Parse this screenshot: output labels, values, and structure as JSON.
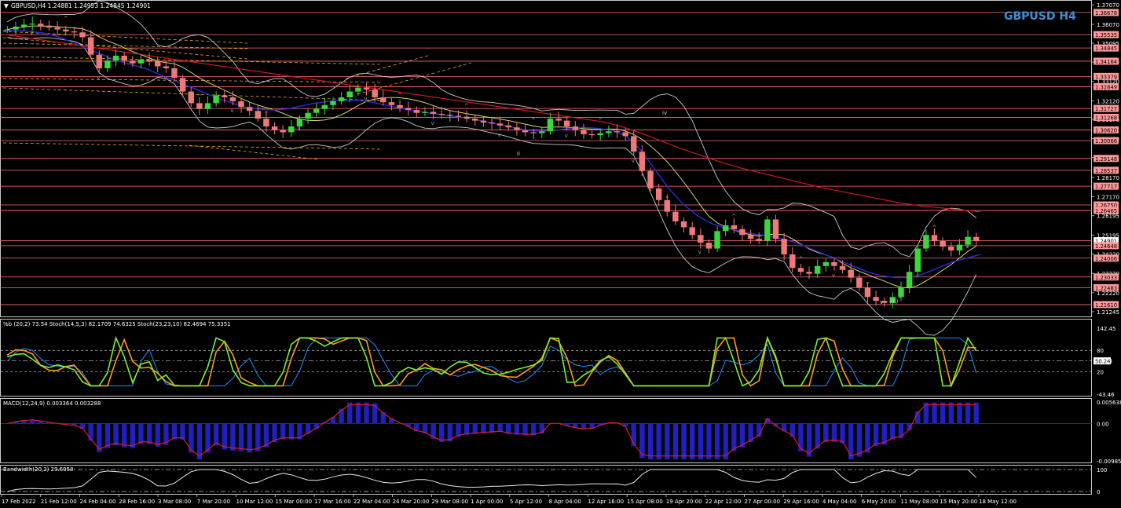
{
  "header": {
    "main": "GBPUSD,H4  1.24881 1.24953 1.24845 1.24901",
    "symbol_title": "GBPUSD H4"
  },
  "colors": {
    "bg": "#000000",
    "grid_frame": "#c8c8c8",
    "level_line": "#ff6e6e",
    "badge": "#ff9898",
    "bull": "#3ad83a",
    "bear": "#f07878",
    "ma_blue": "#2b2bd8",
    "ma_red": "#d01818",
    "ma_yellow": "#e8e86a",
    "bands": "#c8c8c8",
    "fib": "#e8a620",
    "title": "#3e8fd6",
    "stoch_green": "#7cf02c",
    "stoch_orange": "#ff9a1c",
    "pctb_blue": "#1e90ff",
    "macd_hist": "#2020c0",
    "macd_signal": "#e01c1c",
    "bw_line": "#e8e8e8"
  },
  "price_axis": {
    "labels": [
      "1.37070",
      "1.36070",
      "1.35095",
      "1.34120",
      "1.33120",
      "1.32120",
      "1.31170",
      "1.30170",
      "1.29195",
      "1.28170",
      "1.27170",
      "1.26195",
      "1.25195",
      "1.24220",
      "1.23220",
      "1.22220",
      "1.21245"
    ]
  },
  "levels": [
    "1.36678",
    "1.35535",
    "1.34845",
    "1.34164",
    "1.33379",
    "1.32849",
    "1.31727",
    "1.31268",
    "1.30620",
    "1.30066",
    "1.29148",
    "1.28537",
    "1.27717",
    "1.26750",
    "1.26465",
    "1.24901",
    "1.24648",
    "1.24006",
    "1.23033",
    "1.22483",
    "1.21610"
  ],
  "wave_labels": [
    "iv",
    "ii",
    "v",
    "(iii)"
  ],
  "time_axis": [
    "17 Feb 2022",
    "21 Feb 12:00",
    "24 Feb 04:00",
    "28 Feb 16:00",
    "3 Mar 08:00",
    "7 Mar 20:00",
    "10 Mar 12:00",
    "15 Mar 00:00",
    "17 Mar 16:00",
    "22 Mar 04:00",
    "24 Mar 20:00",
    "29 Mar 08:00",
    "1 Apr 00:00",
    "5 Apr 12:00",
    "8 Apr 04:00",
    "12 Apr 16:00",
    "15 Apr 08:00",
    "19 Apr 20:00",
    "22 Apr 12:00",
    "27 Apr 00:00",
    "29 Apr 16:00",
    "4 May 04:00",
    "6 May 20:00",
    "11 May 08:00",
    "15 May 20:00",
    "18 May 12:00"
  ],
  "osc": {
    "title": "%b (20,2) 73.54  Stoch(14,5,3) 82.1709 74.6325  Stoch(23,23,10) 82.4694 75.3351",
    "axis": [
      "142.45",
      "80",
      "50.24",
      "20",
      "-43.46"
    ]
  },
  "macd": {
    "title": "MACD(12,24,9) 0.003364 0.003288",
    "axis": [
      "0.005638",
      "0.00",
      "-0.009858"
    ]
  },
  "bandwidth": {
    "title": "Bandwidth(20,2) 29.6958",
    "axis": [
      "100",
      "0"
    ]
  },
  "chart_data": {
    "type": "candlestick",
    "symbol": "GBPUSD",
    "timeframe": "H4",
    "ohlc_last": {
      "open": 1.24881,
      "high": 1.24953,
      "low": 1.24845,
      "close": 1.24901
    },
    "close_series": [
      1.358,
      1.3595,
      1.3605,
      1.361,
      1.36,
      1.359,
      1.358,
      1.357,
      1.3565,
      1.354,
      1.345,
      1.338,
      1.342,
      1.3445,
      1.342,
      1.3405,
      1.3425,
      1.3415,
      1.339,
      1.338,
      1.333,
      1.326,
      1.32,
      1.317,
      1.32,
      1.324,
      1.323,
      1.321,
      1.318,
      1.316,
      1.312,
      1.308,
      1.306,
      1.305,
      1.308,
      1.312,
      1.315,
      1.317,
      1.319,
      1.321,
      1.323,
      1.326,
      1.328,
      1.327,
      1.323,
      1.3205,
      1.319,
      1.3175,
      1.3165,
      1.315,
      1.3155,
      1.3145,
      1.314,
      1.3135,
      1.313,
      1.312,
      1.311,
      1.31,
      1.3095,
      1.3085,
      1.3075,
      1.306,
      1.305,
      1.3045,
      1.3055,
      1.312,
      1.311,
      1.308,
      1.306,
      1.304,
      1.3035,
      1.3045,
      1.3055,
      1.305,
      1.303,
      1.295,
      1.285,
      1.276,
      1.27,
      1.264,
      1.259,
      1.256,
      1.252,
      1.248,
      1.245,
      1.254,
      1.257,
      1.255,
      1.252,
      1.25,
      1.249,
      1.26,
      1.25,
      1.242,
      1.235,
      1.233,
      1.232,
      1.236,
      1.238,
      1.236,
      1.234,
      1.23,
      1.225,
      1.22,
      1.218,
      1.217,
      1.22,
      1.225,
      1.233,
      1.245,
      1.252,
      1.249,
      1.246,
      1.244,
      1.247,
      1.251,
      1.249
    ],
    "ma_blue": [
      1.3575,
      1.3575,
      1.357,
      1.356,
      1.354,
      1.351,
      1.348,
      1.345,
      1.342,
      1.34,
      1.338,
      1.335,
      1.332,
      1.329,
      1.326,
      1.323,
      1.3205,
      1.318,
      1.317,
      1.3165,
      1.317,
      1.3185,
      1.32,
      1.321,
      1.3215,
      1.3215,
      1.3205,
      1.319,
      1.3175,
      1.316,
      1.315,
      1.314,
      1.313,
      1.312,
      1.3105,
      1.309,
      1.3075,
      1.306,
      1.3055,
      1.306,
      1.307,
      1.3075,
      1.307,
      1.306,
      1.303,
      1.296,
      1.286,
      1.276,
      1.268,
      1.262,
      1.258,
      1.2555,
      1.254,
      1.2525,
      1.2515,
      1.25,
      1.248,
      1.245,
      1.242,
      1.239,
      1.236,
      1.233,
      1.231,
      1.23,
      1.23,
      1.232,
      1.235,
      1.238,
      1.24,
      1.242
    ],
    "ma_red": [
      1.3555,
      1.354,
      1.3525,
      1.351,
      1.3495,
      1.348,
      1.3465,
      1.345,
      1.3435,
      1.342,
      1.3405,
      1.339,
      1.3375,
      1.336,
      1.3345,
      1.333,
      1.3315,
      1.33,
      1.3285,
      1.327,
      1.3255,
      1.324,
      1.3225,
      1.321,
      1.3195,
      1.318,
      1.3165,
      1.315,
      1.3135,
      1.312,
      1.3105,
      1.308,
      1.3045,
      1.3005,
      1.2965,
      1.293,
      1.2895,
      1.2865,
      1.284,
      1.2815,
      1.279,
      1.2765,
      1.2745,
      1.2725,
      1.2705,
      1.2685,
      1.267,
      1.266,
      1.265,
      1.264
    ]
  }
}
